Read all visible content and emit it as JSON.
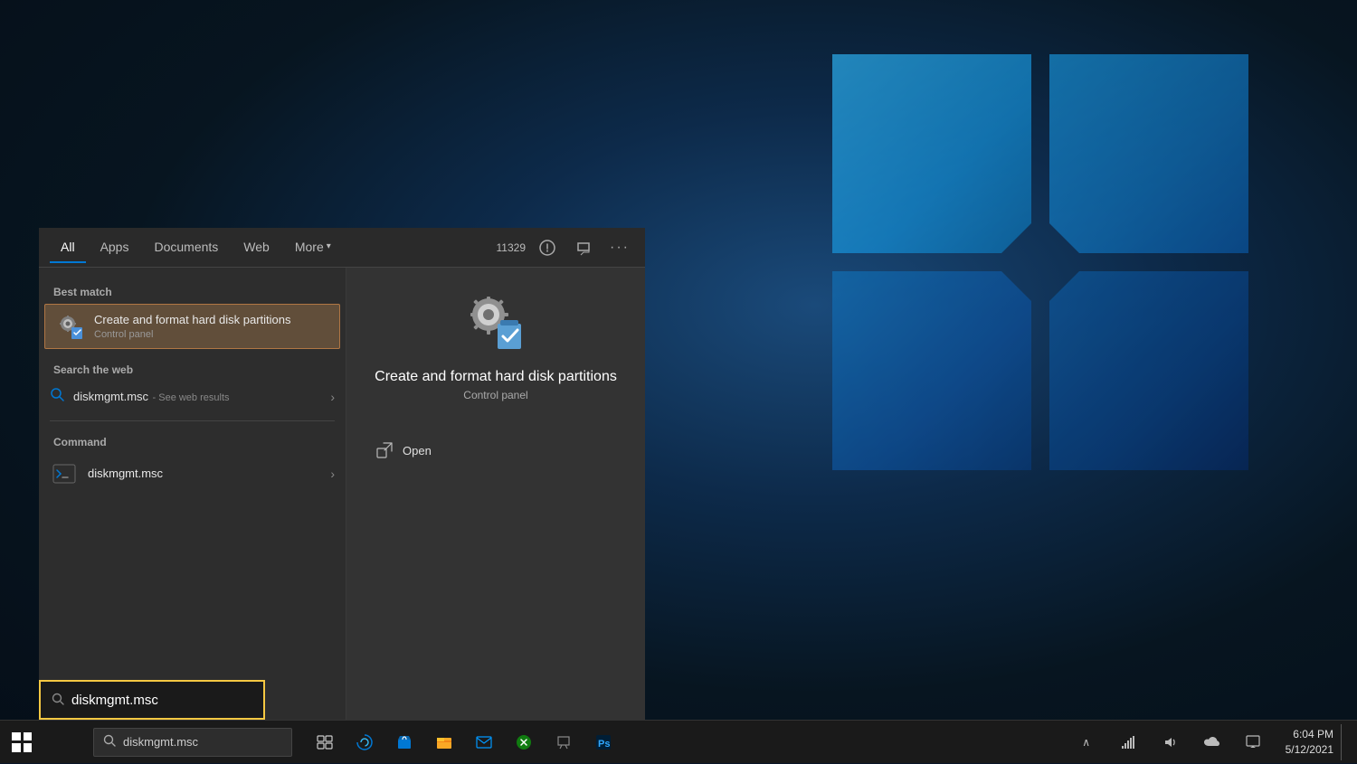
{
  "desktop": {
    "background": "Windows 10 desktop"
  },
  "taskbar": {
    "search_placeholder": "diskmgmt.msc",
    "clock": "6:04 PM",
    "date": "5/12/2021",
    "start_label": "Start",
    "icons": [
      "task-view",
      "edge",
      "store",
      "file-explorer",
      "mail",
      "xbox",
      "snip",
      "photoshop"
    ]
  },
  "start_menu": {
    "tabs": [
      {
        "id": "all",
        "label": "All",
        "active": true
      },
      {
        "id": "apps",
        "label": "Apps",
        "active": false
      },
      {
        "id": "documents",
        "label": "Documents",
        "active": false
      },
      {
        "id": "web",
        "label": "Web",
        "active": false
      },
      {
        "id": "more",
        "label": "More",
        "active": false
      }
    ],
    "badge": "11329",
    "best_match_label": "Best match",
    "best_match": {
      "title": "Create and format hard disk partitions",
      "subtitle": "Control panel",
      "selected": true
    },
    "search_web_label": "Search the web",
    "web_search": {
      "query": "diskmgmt.msc",
      "sub": "- See web results"
    },
    "command_label": "Command",
    "command": {
      "title": "diskmgmt.msc"
    },
    "right_panel": {
      "app_title": "Create and format hard disk partitions",
      "app_subtitle": "Control panel",
      "actions": [
        {
          "label": "Open",
          "icon": "open-icon"
        }
      ]
    }
  },
  "search_box": {
    "value": "diskmgmt.msc",
    "icon": "search-icon"
  }
}
